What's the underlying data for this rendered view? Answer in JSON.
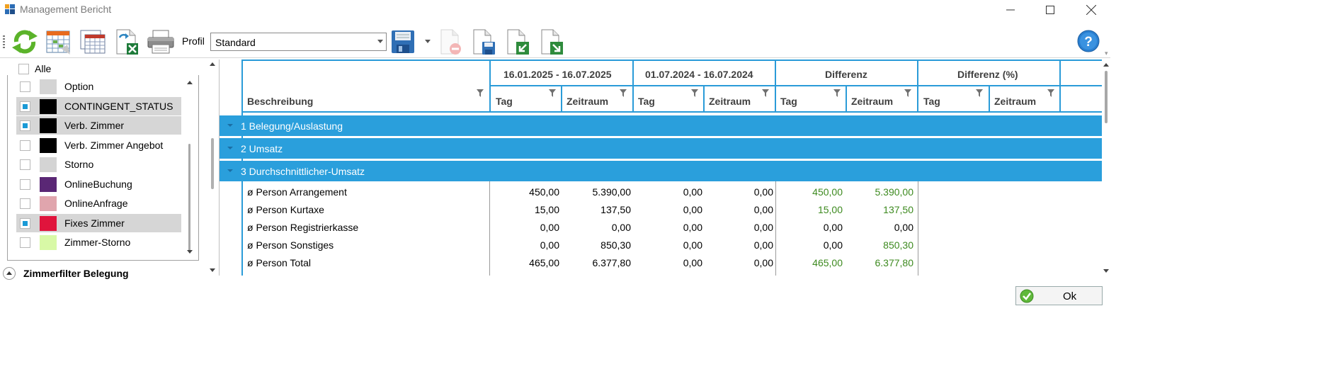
{
  "window": {
    "title": "Management Bericht"
  },
  "toolbar": {
    "profil_label": "Profil",
    "profil_value": "Standard",
    "buttons": [
      "refresh-icon",
      "calendar-grid-icon",
      "table-icon",
      "excel-export-icon",
      "print-icon",
      "save-icon",
      "delete-icon",
      "save-as-icon",
      "import-icon",
      "export-icon"
    ]
  },
  "filter_panel": {
    "all_label": "Alle",
    "items": [
      {
        "label": "Option",
        "color": "#d4d4d4",
        "checked": false,
        "selected": false
      },
      {
        "label": "CONTINGENT_STATUS",
        "color": "#000000",
        "checked": true,
        "selected": true
      },
      {
        "label": "Verb. Zimmer",
        "color": "#000000",
        "checked": true,
        "selected": true
      },
      {
        "label": "Verb. Zimmer Angebot",
        "color": "#000000",
        "checked": false,
        "selected": false
      },
      {
        "label": "Storno",
        "color": "#d4d4d4",
        "checked": false,
        "selected": false
      },
      {
        "label": "OnlineBuchung",
        "color": "#5a2775",
        "checked": false,
        "selected": false
      },
      {
        "label": "OnlineAnfrage",
        "color": "#e0a5ad",
        "checked": false,
        "selected": false
      },
      {
        "label": "Fixes Zimmer",
        "color": "#e0143c",
        "checked": true,
        "selected": true
      },
      {
        "label": "Zimmer-Storno",
        "color": "#d8f9a6",
        "checked": false,
        "selected": false
      }
    ],
    "section_title": "Zimmerfilter Belegung"
  },
  "grid": {
    "band_headers": [
      "16.01.2025 - 16.07.2025",
      "01.07.2024 - 16.07.2024",
      "Differenz",
      "Differenz (%)"
    ],
    "columns": [
      "Beschreibung",
      "Tag",
      "Zeitraum",
      "Tag",
      "Zeitraum",
      "Tag",
      "Zeitraum",
      "Tag",
      "Zeitraum"
    ],
    "groups": [
      "1 Belegung/Auslastung",
      "2 Umsatz",
      "3 Durchschnittlicher-Umsatz"
    ],
    "rows": [
      {
        "desc": "ø Person Arrangement",
        "v": [
          "450,00",
          "5.390,00",
          "0,00",
          "0,00",
          "450,00",
          "5.390,00",
          "",
          ""
        ]
      },
      {
        "desc": "ø Person Kurtaxe",
        "v": [
          "15,00",
          "137,50",
          "0,00",
          "0,00",
          "15,00",
          "137,50",
          "",
          ""
        ]
      },
      {
        "desc": "ø Person Registrierkasse",
        "v": [
          "0,00",
          "0,00",
          "0,00",
          "0,00",
          "0,00",
          "0,00",
          "",
          ""
        ]
      },
      {
        "desc": "ø Person Sonstiges",
        "v": [
          "0,00",
          "850,30",
          "0,00",
          "0,00",
          "0,00",
          "850,30",
          "",
          ""
        ]
      },
      {
        "desc": "ø Person Total",
        "v": [
          "465,00",
          "6.377,80",
          "0,00",
          "0,00",
          "465,00",
          "6.377,80",
          "",
          ""
        ]
      }
    ]
  },
  "footer": {
    "ok_label": "Ok"
  },
  "colors": {
    "group_band": "#2a9fdc",
    "positive_diff": "#3d8a1f",
    "selection": "#d6d6d6"
  }
}
